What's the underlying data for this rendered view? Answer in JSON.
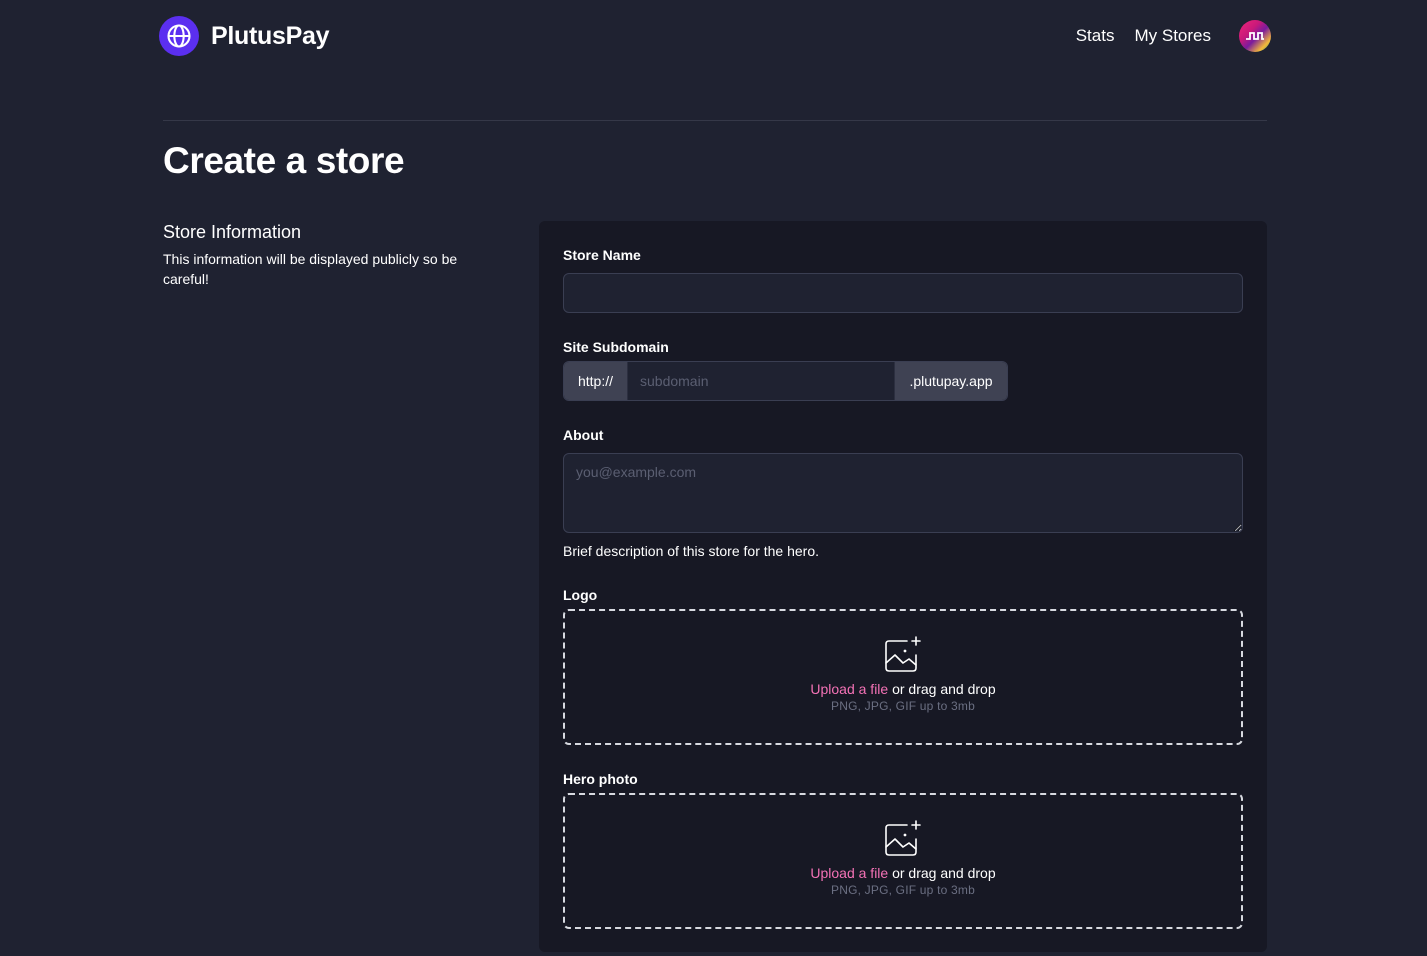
{
  "brand": {
    "name": "PlutusPay"
  },
  "nav": {
    "stats": "Stats",
    "my_stores": "My Stores"
  },
  "page": {
    "title": "Create a store"
  },
  "section": {
    "title": "Store Information",
    "description": "This information will be displayed publicly so be careful!"
  },
  "form": {
    "store_name": {
      "label": "Store Name",
      "value": ""
    },
    "subdomain": {
      "label": "Site Subdomain",
      "prefix": "http://",
      "placeholder": "subdomain",
      "suffix": ".plutupay.app"
    },
    "about": {
      "label": "About",
      "placeholder": "you@example.com",
      "help": "Brief description of this store for the hero."
    },
    "logo": {
      "label": "Logo",
      "upload_link": "Upload a file",
      "upload_text": " or drag and drop",
      "hint": "PNG, JPG, GIF up to 3mb"
    },
    "hero_photo": {
      "label": "Hero photo",
      "upload_link": "Upload a file",
      "upload_text": " or drag and drop",
      "hint": "PNG, JPG, GIF up to 3mb"
    }
  },
  "colors": {
    "background": "#1f2231",
    "panel": "#171824",
    "brand": "#5b2ff0",
    "link": "#f472b6"
  },
  "icons": {
    "logo": "globe-icon",
    "avatar": "user-avatar",
    "upload": "image-add-icon"
  }
}
